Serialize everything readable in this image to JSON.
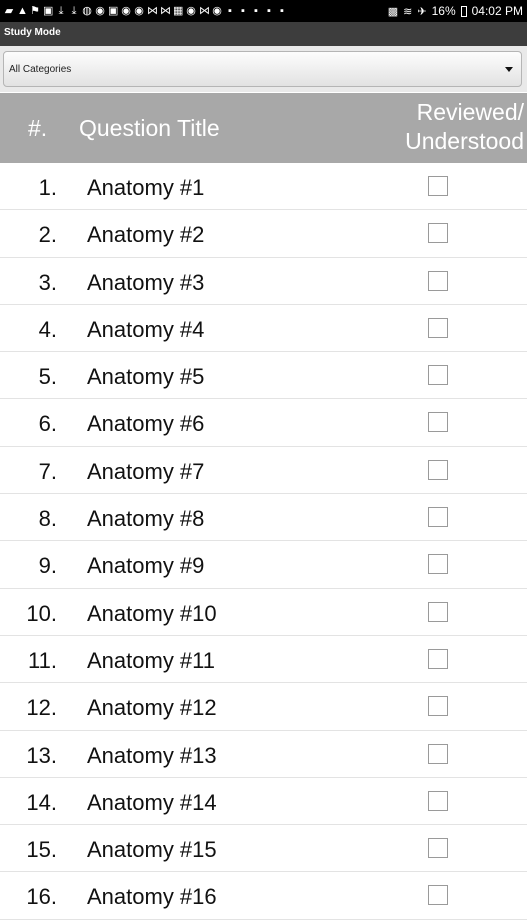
{
  "status_bar": {
    "left_icons": [
      "▰",
      "▲",
      "⚑",
      "▣",
      "⤓",
      "⤓",
      "◍",
      "◉",
      "▣",
      "◉",
      "◉",
      "⋈",
      "⋈",
      "▦",
      "◉",
      "⋈",
      "◉",
      "▪",
      "▪",
      "▪",
      "▪",
      "▪"
    ],
    "right": {
      "nfc": "▩",
      "wifi": "≋",
      "airplane": "✈",
      "battery": "16%",
      "time": "04:02 PM"
    }
  },
  "app": {
    "title": "Study Mode"
  },
  "filter": {
    "selected": "All Categories"
  },
  "table": {
    "columns": {
      "number": "#.",
      "title": "Question Title",
      "reviewed_line1": "Reviewed/",
      "reviewed_line2": "Understood"
    },
    "rows": [
      {
        "num": "1.",
        "title": "Anatomy #1",
        "checked": false
      },
      {
        "num": "2.",
        "title": "Anatomy #2",
        "checked": false
      },
      {
        "num": "3.",
        "title": "Anatomy #3",
        "checked": false
      },
      {
        "num": "4.",
        "title": "Anatomy #4",
        "checked": false
      },
      {
        "num": "5.",
        "title": "Anatomy #5",
        "checked": false
      },
      {
        "num": "6.",
        "title": "Anatomy #6",
        "checked": false
      },
      {
        "num": "7.",
        "title": "Anatomy #7",
        "checked": false
      },
      {
        "num": "8.",
        "title": "Anatomy #8",
        "checked": false
      },
      {
        "num": "9.",
        "title": "Anatomy #9",
        "checked": false
      },
      {
        "num": "10.",
        "title": "Anatomy #10",
        "checked": false
      },
      {
        "num": "11.",
        "title": "Anatomy #11",
        "checked": false
      },
      {
        "num": "12.",
        "title": "Anatomy #12",
        "checked": false
      },
      {
        "num": "13.",
        "title": "Anatomy #13",
        "checked": false
      },
      {
        "num": "14.",
        "title": "Anatomy #14",
        "checked": false
      },
      {
        "num": "15.",
        "title": "Anatomy #15",
        "checked": false
      },
      {
        "num": "16.",
        "title": "Anatomy #16",
        "checked": false
      }
    ]
  }
}
